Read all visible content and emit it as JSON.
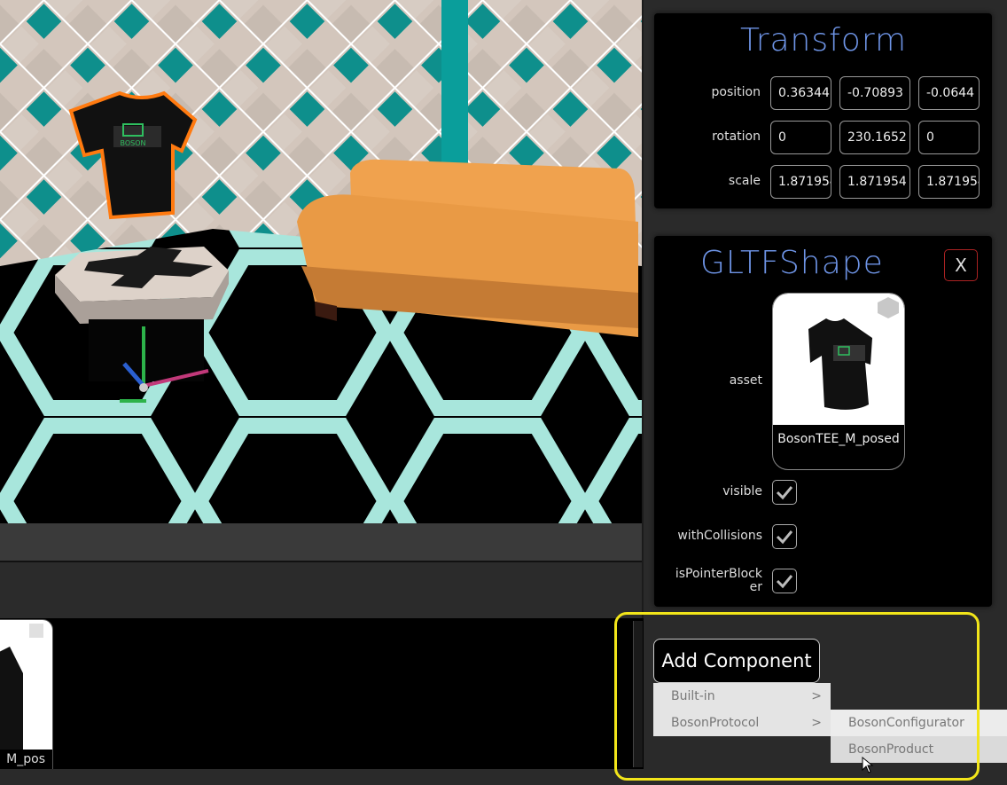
{
  "transform": {
    "title": "Transform",
    "rows": [
      {
        "label": "position",
        "values": [
          "0.36344",
          "-0.70893",
          "-0.0644"
        ]
      },
      {
        "label": "rotation",
        "values": [
          "0",
          "230.1652",
          "0"
        ]
      },
      {
        "label": "scale",
        "values": [
          "1.871954",
          "1.871954",
          "1.871954"
        ]
      }
    ]
  },
  "gltf": {
    "title": "GLTFShape",
    "close_label": "X",
    "asset_label": "asset",
    "asset_name": "BosonTEE_M_posed",
    "visible_label": "visible",
    "collisions_label": "withCollisions",
    "pointer_label": "isPointerBlocker",
    "visible": true,
    "withCollisions": true,
    "isPointerBlocker": true
  },
  "add_component": {
    "button_label": "Add Component",
    "menu": [
      {
        "label": "Built-in",
        "arrow": ">"
      },
      {
        "label": "BosonProtocol",
        "arrow": ">"
      }
    ],
    "submenu": [
      "BosonConfigurator",
      "BosonProduct"
    ]
  },
  "asset_browser": {
    "item_label": "M_pos"
  },
  "scene": {
    "shirt_logo_text": "BOSON"
  },
  "colors": {
    "title_blue": "#6e94e6",
    "highlight_yellow": "#f2e51a",
    "floor_glow": "#a8e6dc",
    "sofa": "#f0a24e"
  }
}
